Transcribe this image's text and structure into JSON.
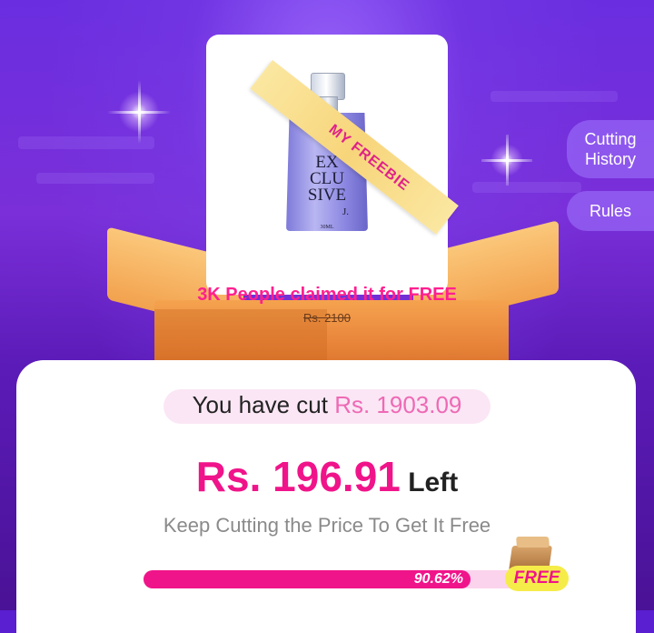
{
  "product": {
    "ribbon_label": "MY FREEBIE",
    "bottle_text": "EX CLU SIVE",
    "bottle_mark": "J.",
    "bottle_volume": "30ML",
    "claimed_text": "3K People claimed it for FREE",
    "original_price": "Rs. 2100"
  },
  "side_buttons": {
    "cutting_history": "Cutting History",
    "rules": "Rules"
  },
  "summary": {
    "cut_prefix": "You have cut ",
    "cut_amount": "Rs. 1903.09",
    "left_amount": "Rs. 196.91",
    "left_suffix": " Left",
    "instruction": "Keep Cutting the Price To Get It Free"
  },
  "progress": {
    "percent_label": "90.62%",
    "percent_value": 90.62,
    "goal_label": "FREE"
  },
  "colors": {
    "accent_pink": "#f0148a",
    "background_purple": "#5a1fd0",
    "free_tag_yellow": "#f5ec4a"
  }
}
